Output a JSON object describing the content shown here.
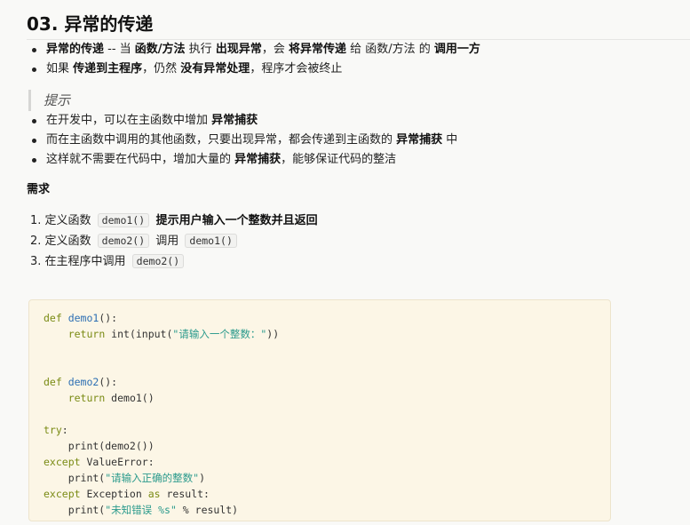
{
  "heading": "03. 异常的传递",
  "bullets_top": [
    [
      {
        "t": "异常的传递",
        "b": true
      },
      {
        "t": " -- 当 ",
        "b": false
      },
      {
        "t": "函数/方法",
        "b": true
      },
      {
        "t": " 执行 ",
        "b": false
      },
      {
        "t": "出现异常",
        "b": true
      },
      {
        "t": "，会 ",
        "b": false
      },
      {
        "t": "将异常传递",
        "b": true
      },
      {
        "t": " 给 函数/方法 的 ",
        "b": false
      },
      {
        "t": "调用一方",
        "b": true
      }
    ],
    [
      {
        "t": "如果 ",
        "b": false
      },
      {
        "t": "传递到主程序",
        "b": true
      },
      {
        "t": "，仍然 ",
        "b": false
      },
      {
        "t": "没有异常处理",
        "b": true
      },
      {
        "t": "，程序才会被终止",
        "b": false
      }
    ]
  ],
  "quote": "提示",
  "bullets_tips": [
    [
      {
        "t": "在开发中，可以在主函数中增加 ",
        "b": false
      },
      {
        "t": "异常捕获",
        "b": true
      }
    ],
    [
      {
        "t": "而在主函数中调用的其他函数，只要出现异常，都会传递到主函数的 ",
        "b": false
      },
      {
        "t": "异常捕获",
        "b": true
      },
      {
        "t": " 中",
        "b": false
      }
    ],
    [
      {
        "t": "这样就不需要在代码中，增加大量的 ",
        "b": false
      },
      {
        "t": "异常捕获",
        "b": true
      },
      {
        "t": "，能够保证代码的整洁",
        "b": false
      }
    ]
  ],
  "requirements_heading": "需求",
  "steps": [
    [
      {
        "t": "1. 定义函数 ",
        "k": "text"
      },
      {
        "t": "demo1()",
        "k": "code"
      },
      {
        "t": " 提示用户输入一个整数并且返回",
        "k": "bold"
      }
    ],
    [
      {
        "t": "2. 定义函数 ",
        "k": "text"
      },
      {
        "t": "demo2()",
        "k": "code"
      },
      {
        "t": " 调用 ",
        "k": "text"
      },
      {
        "t": "demo1()",
        "k": "code"
      }
    ],
    [
      {
        "t": "3. 在主程序中调用 ",
        "k": "text"
      },
      {
        "t": "demo2()",
        "k": "code"
      }
    ]
  ],
  "code_lines": [
    [
      {
        "t": "def ",
        "k": "kw"
      },
      {
        "t": "demo1",
        "k": "fn"
      },
      {
        "t": "():",
        "k": ""
      }
    ],
    [
      {
        "t": "    ",
        "k": ""
      },
      {
        "t": "return",
        "k": "kw"
      },
      {
        "t": " int(input(",
        "k": ""
      },
      {
        "t": "\"请输入一个整数：\"",
        "k": "str"
      },
      {
        "t": "))",
        "k": ""
      }
    ],
    [],
    [],
    [
      {
        "t": "def ",
        "k": "kw"
      },
      {
        "t": "demo2",
        "k": "fn"
      },
      {
        "t": "():",
        "k": ""
      }
    ],
    [
      {
        "t": "    ",
        "k": ""
      },
      {
        "t": "return",
        "k": "kw"
      },
      {
        "t": " demo1()",
        "k": ""
      }
    ],
    [],
    [
      {
        "t": "try",
        "k": "kw"
      },
      {
        "t": ":",
        "k": ""
      }
    ],
    [
      {
        "t": "    print(demo2())",
        "k": ""
      }
    ],
    [
      {
        "t": "except",
        "k": "kw"
      },
      {
        "t": " ValueError:",
        "k": ""
      }
    ],
    [
      {
        "t": "    print(",
        "k": ""
      },
      {
        "t": "\"请输入正确的整数\"",
        "k": "str"
      },
      {
        "t": ")",
        "k": ""
      }
    ],
    [
      {
        "t": "except",
        "k": "kw"
      },
      {
        "t": " Exception ",
        "k": ""
      },
      {
        "t": "as",
        "k": "kw"
      },
      {
        "t": " result:",
        "k": ""
      }
    ],
    [
      {
        "t": "    print(",
        "k": ""
      },
      {
        "t": "\"未知错误 %s\"",
        "k": "str"
      },
      {
        "t": " % result)",
        "k": ""
      }
    ]
  ]
}
